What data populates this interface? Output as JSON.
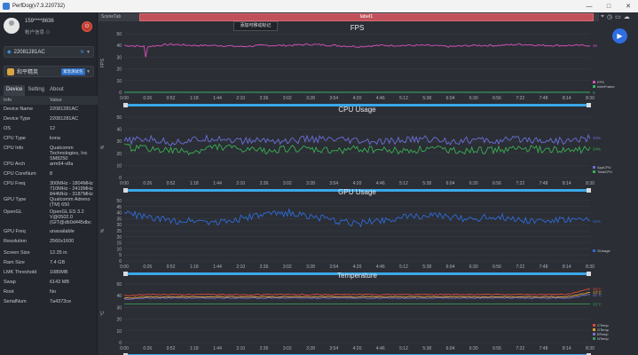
{
  "window": {
    "title": "PerfDog(v7.3.220732)",
    "buttons": [
      "—",
      "□",
      "✕"
    ]
  },
  "account": {
    "username": "159****8636",
    "subtitle": "帐户信息"
  },
  "device": {
    "name": "22081281AC"
  },
  "app": {
    "name": "和平精英",
    "tag": "紧急测试包"
  },
  "tabs": [
    {
      "label": "Device",
      "active": true
    },
    {
      "label": "Setting",
      "active": false
    },
    {
      "label": "About",
      "active": false
    }
  ],
  "info": {
    "header": [
      "Info",
      "Value"
    ],
    "rows": [
      {
        "k": "Device Name",
        "v": "22081281AC"
      },
      {
        "k": "Device Type",
        "v": "22081281AC"
      },
      {
        "k": "OS",
        "v": "12"
      },
      {
        "k": "CPU Type",
        "v": "kona"
      },
      {
        "k": "CPU Info",
        "v": "Qualcomm Technologies, Inc SM8250"
      },
      {
        "k": "CPU Arch",
        "v": "arm64-v8a"
      },
      {
        "k": "CPU CoreNum",
        "v": "8"
      },
      {
        "k": "CPU Freq",
        "v": "300MHz - 1804MHz 710MHz - 2419MHz 844MHz - 3187MHz"
      },
      {
        "k": "GPU Type",
        "v": "Qualcomm Adreno (TM) 650"
      },
      {
        "k": "OpenGL",
        "v": "OpenGL ES 3.2 V@0502.0 (GIT@db0d445dbc"
      },
      {
        "k": "GPU Freq",
        "v": "unavailable"
      },
      {
        "k": "Resolution",
        "v": "2560x1600"
      },
      {
        "k": "Screen Size",
        "v": "12.35 in"
      },
      {
        "k": "Ram Size",
        "v": "7.4 GB"
      },
      {
        "k": "LMK Threshold",
        "v": "1080MB"
      },
      {
        "k": "Swap",
        "v": "6143 MB"
      },
      {
        "k": "Root",
        "v": "No"
      },
      {
        "k": "SerialNum",
        "v": "7a4373ce"
      }
    ]
  },
  "scene": {
    "tab_label": "SceneTab",
    "label_bar": "label1",
    "tooltip": "添加可移动标记"
  },
  "colors": {
    "fps": "#d64fb8",
    "interframe": "#36b36b",
    "appcpu": "#6b6fd6",
    "totalcpu": "#3ab050",
    "gpu": "#2f6bd6",
    "temp1": "#e04a3a",
    "temp2": "#e0a030",
    "temp3": "#7b70d0",
    "temp4": "#3a9a5a",
    "scroll": "#3aa8e8"
  },
  "chart_data": [
    {
      "type": "line",
      "title": "FPS",
      "ylabel": "FPS",
      "ylim": [
        0,
        50
      ],
      "yticks": [
        "50",
        "40",
        "30",
        "20",
        "10",
        "0"
      ],
      "xticks": [
        "0:00",
        "0:26",
        "0:52",
        "1:18",
        "1:44",
        "2:10",
        "2:36",
        "3:02",
        "3:28",
        "3:54",
        "4:20",
        "4:46",
        "5:12",
        "5:38",
        "6:04",
        "6:30",
        "6:56",
        "7:22",
        "7:48",
        "8:14",
        "8:30"
      ],
      "series": [
        {
          "name": "FPS",
          "values": [
            40,
            39,
            41,
            40,
            40,
            39,
            40,
            40,
            41,
            40,
            39,
            40,
            40,
            40,
            39,
            40,
            40,
            41,
            40,
            40,
            40
          ],
          "end_label": "40"
        },
        {
          "name": "InterFrame",
          "values": [
            0,
            0,
            0,
            0,
            0,
            0,
            0,
            0,
            0,
            0,
            0,
            0,
            0,
            0,
            0,
            0,
            0,
            0,
            0,
            0,
            0
          ],
          "end_label": "0"
        }
      ]
    },
    {
      "type": "line",
      "title": "CPU Usage",
      "ylabel": "%",
      "ylim": [
        0,
        50
      ],
      "yticks": [
        "50",
        "40",
        "30",
        "20",
        "10",
        "0"
      ],
      "xticks": [
        "0:00",
        "0:26",
        "0:52",
        "1:18",
        "1:44",
        "2:10",
        "2:36",
        "3:02",
        "3:28",
        "3:54",
        "4:20",
        "4:46",
        "5:12",
        "5:38",
        "6:04",
        "6:30",
        "6:56",
        "7:22",
        "7:48",
        "8:14",
        "8:30"
      ],
      "series": [
        {
          "name": "AppCPU",
          "values": [
            30,
            32,
            29,
            31,
            33,
            30,
            31,
            30,
            32,
            31,
            30,
            29,
            31,
            32,
            30,
            31,
            30,
            32,
            31,
            30,
            33
          ],
          "end_label": "33%"
        },
        {
          "name": "TotalCPU",
          "values": [
            25,
            24,
            22,
            21,
            26,
            23,
            22,
            24,
            23,
            22,
            24,
            23,
            22,
            24,
            23,
            22,
            23,
            24,
            23,
            22,
            24
          ],
          "end_label": "24%"
        }
      ]
    },
    {
      "type": "line",
      "title": "GPU Usage",
      "ylabel": "%",
      "ylim": [
        0,
        50
      ],
      "yticks": [
        "50",
        "45",
        "40",
        "35",
        "30",
        "25",
        "20",
        "15",
        "10",
        "5",
        "0"
      ],
      "xticks": [
        "0:00",
        "0:26",
        "0:52",
        "1:18",
        "1:44",
        "2:10",
        "2:36",
        "3:02",
        "3:28",
        "3:54",
        "4:20",
        "4:46",
        "5:12",
        "5:38",
        "6:04",
        "6:30",
        "6:56",
        "7:22",
        "7:48",
        "8:14",
        "8:30"
      ],
      "series": [
        {
          "name": "GUsage",
          "values": [
            40,
            36,
            33,
            34,
            32,
            35,
            38,
            40,
            37,
            33,
            31,
            34,
            36,
            38,
            36,
            35,
            37,
            34,
            33,
            34,
            33
          ],
          "end_label": "33%"
        }
      ]
    },
    {
      "type": "line",
      "title": "Temperature",
      "ylabel": "°C",
      "ylim": [
        0,
        50
      ],
      "yticks": [
        "50",
        "40",
        "30",
        "20",
        "10",
        "0"
      ],
      "xticks": [
        "0:00",
        "0:26",
        "0:52",
        "1:18",
        "1:44",
        "2:10",
        "2:36",
        "3:02",
        "3:28",
        "3:54",
        "4:20",
        "4:46",
        "5:12",
        "5:38",
        "6:04",
        "6:30",
        "6:56",
        "7:22",
        "7:48",
        "8:14",
        "8:30"
      ],
      "series": [
        {
          "name": "CTemp",
          "values": [
            40,
            41,
            41,
            41,
            41,
            41,
            41,
            41,
            41,
            41,
            41,
            41,
            41,
            41,
            41,
            41,
            41,
            41,
            41,
            41,
            46
          ],
          "end_label": "46°C"
        },
        {
          "name": "GTemp",
          "values": [
            38,
            39,
            39,
            39,
            39,
            39,
            39,
            39,
            39,
            39,
            39,
            39,
            39,
            39,
            39,
            39,
            39,
            39,
            39,
            39,
            43
          ],
          "end_label": "43°C"
        },
        {
          "name": "BTemp",
          "values": [
            37,
            38,
            38,
            38,
            38,
            38,
            38,
            38,
            38,
            38,
            38,
            38,
            38,
            38,
            38,
            38,
            38,
            38,
            38,
            38,
            41
          ],
          "end_label": "41°C"
        },
        {
          "name": "NTemp",
          "values": [
            33,
            33,
            33,
            33,
            33,
            33,
            33,
            33,
            33,
            33,
            33,
            33,
            33,
            33,
            33,
            33,
            33,
            33,
            33,
            33,
            33
          ],
          "end_label": "33°C"
        }
      ]
    }
  ]
}
